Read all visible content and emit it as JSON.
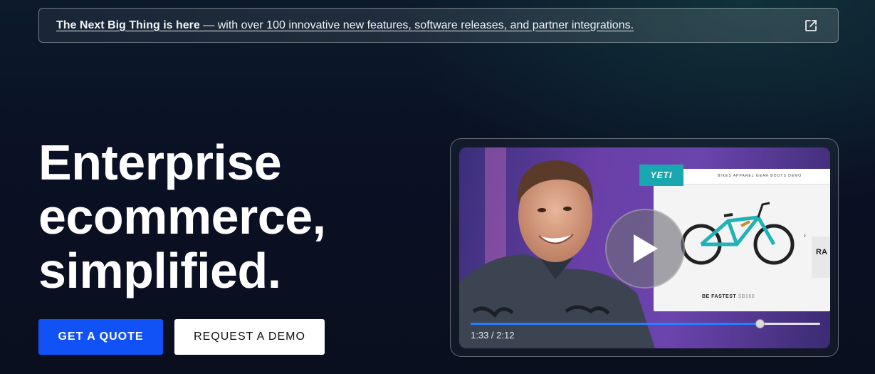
{
  "banner": {
    "bold_text": "The Next Big Thing is here",
    "rest_text": " — with over 100 innovative new features, software releases, and partner integrations.",
    "icon": "external-link-icon"
  },
  "hero": {
    "headline_lines": [
      "Enterprise",
      "ecommerce,",
      "simplified."
    ]
  },
  "buttons": {
    "quote_label": "GET A QUOTE",
    "demo_label": "REQUEST A DEMO"
  },
  "video": {
    "play_icon": "play-icon",
    "time_current": "1:33",
    "time_total": "2:12",
    "time_display": "1:33 / 2:12",
    "progress_fraction": 0.826,
    "site": {
      "logo_text": "YETI",
      "nav_links": "BIKES   APPAREL   GEAR   BOOTS   DEMO",
      "caption_main": "BE FASTEST",
      "caption_price": "SB160",
      "side_text": "RA",
      "chevron": "›"
    }
  },
  "colors": {
    "background": "#0a1124",
    "accent_blue": "#1152f6",
    "progress_blue": "#2a7cff"
  }
}
